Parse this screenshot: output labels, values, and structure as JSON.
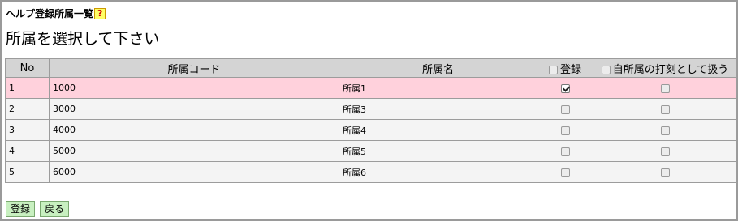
{
  "header": {
    "title": "ヘルプ登録所属一覧",
    "help_label": "?"
  },
  "instruction": "所属を選択して下さい",
  "table": {
    "columns": {
      "no": "No",
      "code": "所属コード",
      "name": "所属名",
      "register": "登録",
      "self_stamp": "自所属の打刻として扱う"
    },
    "rows": [
      {
        "no": "1",
        "code": "1000",
        "name": "所属1",
        "register": true,
        "self_stamp": false,
        "selected": true
      },
      {
        "no": "2",
        "code": "3000",
        "name": "所属3",
        "register": false,
        "self_stamp": false,
        "selected": false
      },
      {
        "no": "3",
        "code": "4000",
        "name": "所属4",
        "register": false,
        "self_stamp": false,
        "selected": false
      },
      {
        "no": "4",
        "code": "5000",
        "name": "所属5",
        "register": false,
        "self_stamp": false,
        "selected": false
      },
      {
        "no": "5",
        "code": "6000",
        "name": "所属6",
        "register": false,
        "self_stamp": false,
        "selected": false
      }
    ]
  },
  "buttons": {
    "register": "登録",
    "back": "戻る"
  },
  "colors": {
    "selected_row": "#ffd1dc",
    "row": "#f4f4f4",
    "header": "#d4d4d4",
    "button": "#c8f0c0",
    "help": "#ffff66"
  }
}
